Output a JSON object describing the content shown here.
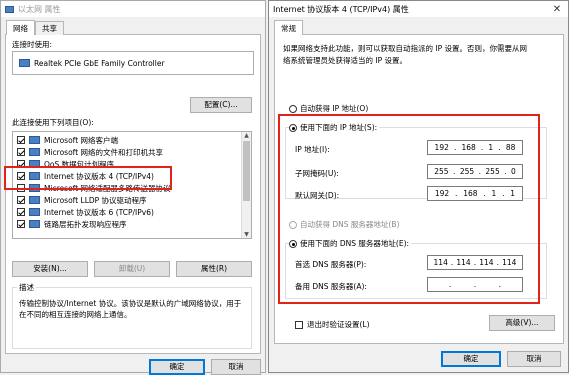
{
  "left_window": {
    "title": "以太网 属性",
    "tabs": [
      "网络",
      "共享"
    ],
    "connect_using_label": "连接时使用:",
    "adapter_name": "Realtek PCIe GbE Family Controller",
    "configure_button": "配置(C)...",
    "items_label": "此连接使用下列项目(O):",
    "items": [
      {
        "label": "Microsoft 网络客户端",
        "checked": true
      },
      {
        "label": "Microsoft 网络的文件和打印机共享",
        "checked": true
      },
      {
        "label": "QoS 数据包计划程序",
        "checked": true
      },
      {
        "label": "Internet 协议版本 4 (TCP/IPv4)",
        "checked": true
      },
      {
        "label": "Microsoft 网络适配器多路传送器协议",
        "checked": false
      },
      {
        "label": "Microsoft LLDP 协议驱动程序",
        "checked": true
      },
      {
        "label": "Internet 协议版本 6 (TCP/IPv6)",
        "checked": true
      },
      {
        "label": "链路层拓扑发现响应程序",
        "checked": true
      }
    ],
    "install_button": "安装(N)...",
    "uninstall_button": "卸载(U)",
    "properties_button": "属性(R)",
    "description_label": "描述",
    "description_text": "传输控制协议/Internet 协议。该协议是默认的广域网络协议，用于在不同的相互连接的网络上通信。",
    "ok_button": "确定",
    "cancel_button": "取消"
  },
  "right_window": {
    "title": "Internet 协议版本 4 (TCP/IPv4) 属性",
    "tab": "常规",
    "intro_line1": "如果网络支持此功能，则可以获取自动指派的 IP 设置。否则，你需要从网",
    "intro_line2": "络系统管理员处获得适当的 IP 设置。",
    "auto_ip_label": "自动获得 IP 地址(O)",
    "use_ip_label": "使用下面的 IP 地址(S):",
    "ip_address_label": "IP 地址(I):",
    "ip_address": [
      "192",
      "168",
      "1",
      "88"
    ],
    "subnet_label": "子网掩码(U):",
    "subnet": [
      "255",
      "255",
      "255",
      "0"
    ],
    "gateway_label": "默认网关(D):",
    "gateway": [
      "192",
      "168",
      "1",
      "1"
    ],
    "auto_dns_label": "自动获得 DNS 服务器地址(B)",
    "use_dns_label": "使用下面的 DNS 服务器地址(E):",
    "preferred_dns_label": "首选 DNS 服务器(P):",
    "preferred_dns": [
      "114",
      "114",
      "114",
      "114"
    ],
    "alternate_dns_label": "备用 DNS 服务器(A):",
    "alternate_dns": [
      "",
      "",
      "",
      ""
    ],
    "validate_label": "退出时验证设置(L)",
    "advanced_button": "高级(V)...",
    "ok_button": "确定",
    "cancel_button": "取消",
    "highlight_color": "#e0241b"
  }
}
